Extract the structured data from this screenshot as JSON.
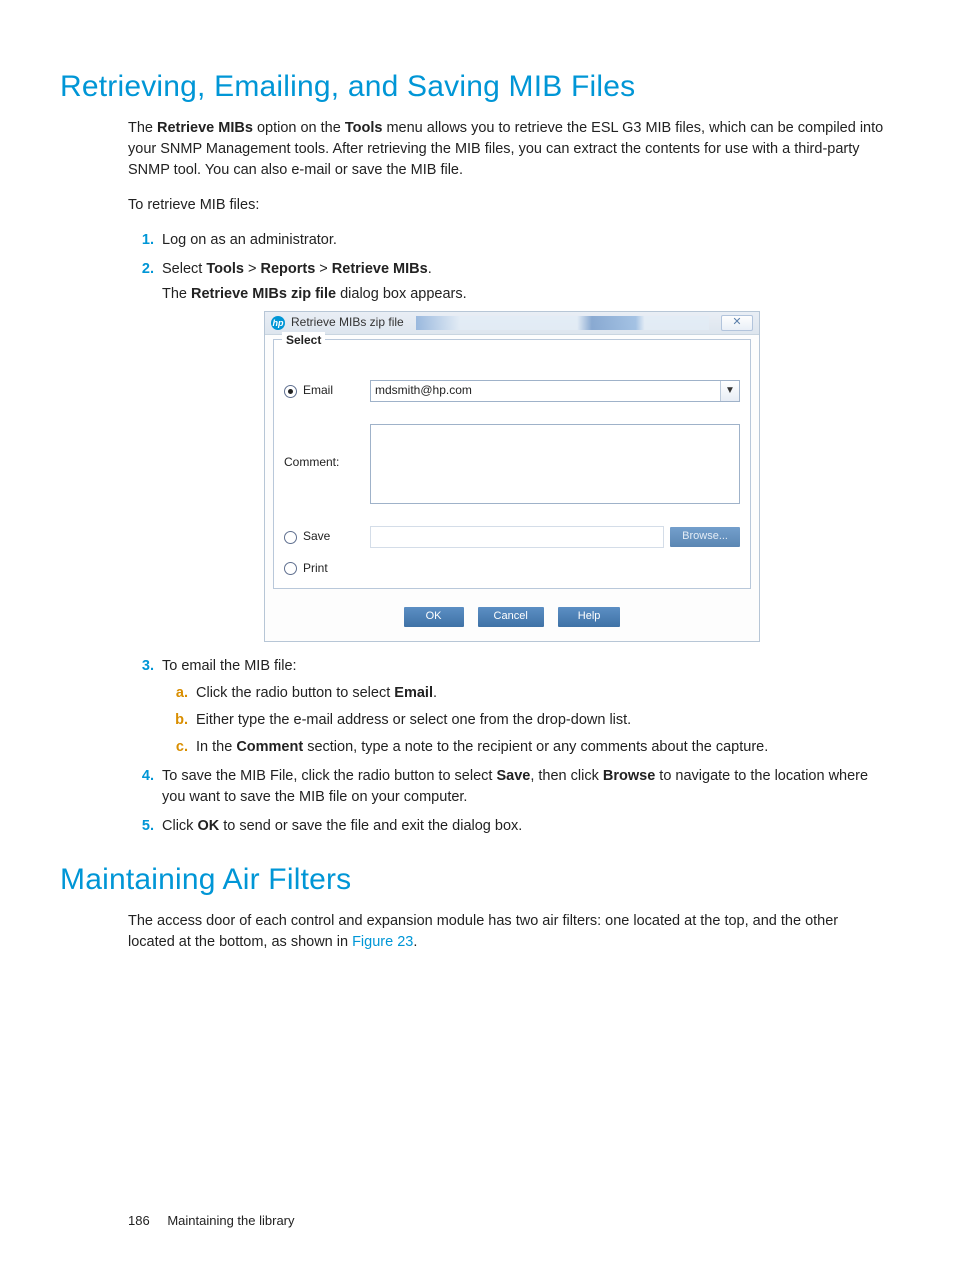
{
  "headings": {
    "h1a": "Retrieving, Emailing, and Saving MIB Files",
    "h1b": "Maintaining Air Filters"
  },
  "intro_parts": {
    "p1_a": "The ",
    "p1_b": "Retrieve MIBs",
    "p1_c": " option on the ",
    "p1_d": "Tools",
    "p1_e": " menu allows you to retrieve the ESL G3 MIB files, which can be compiled into your SNMP Management tools. After retrieving the MIB files, you can extract the contents for use with a third-party SNMP tool. You can also e-mail or save the MIB file.",
    "p2": "To retrieve MIB files:"
  },
  "steps": {
    "s1": "Log on as an administrator.",
    "s2_a": "Select ",
    "s2_b": "Tools",
    "s2_c": " > ",
    "s2_d": "Reports",
    "s2_e": " > ",
    "s2_f": "Retrieve MIBs",
    "s2_g": ".",
    "s2_sub_a": "The ",
    "s2_sub_b": "Retrieve MIBs zip file",
    "s2_sub_c": " dialog box appears.",
    "s3": "To email the MIB file:",
    "s3a_a": "Click the radio button to select ",
    "s3a_b": "Email",
    "s3a_c": ".",
    "s3b": "Either type the e-mail address or select one from the drop-down list.",
    "s3c_a": "In the ",
    "s3c_b": "Comment",
    "s3c_c": " section, type a note to the recipient or any comments about the capture.",
    "s4_a": "To save the MIB File, click the radio button to select ",
    "s4_b": "Save",
    "s4_c": ", then click ",
    "s4_d": "Browse",
    "s4_e": " to navigate to the location where you want to save the MIB file on your computer.",
    "s5_a": "Click ",
    "s5_b": "OK",
    "s5_c": " to send or save the file and exit the dialog box."
  },
  "markers": {
    "n1": "1.",
    "n2": "2.",
    "n3": "3.",
    "n4": "4.",
    "n5": "5.",
    "a": "a.",
    "b": "b.",
    "c": "c."
  },
  "dialog": {
    "title": "Retrieve MIBs zip file",
    "legend": "Select",
    "email_label": "Email",
    "email_value": "mdsmith@hp.com",
    "comment_label": "Comment:",
    "save_label": "Save",
    "print_label": "Print",
    "browse": "Browse...",
    "ok": "OK",
    "cancel": "Cancel",
    "help": "Help",
    "close_glyph": "✕"
  },
  "section2": {
    "p_a": "The access door of each control and expansion module has two air filters: one located at the top, and the other located at the bottom, as shown in ",
    "p_link": "Figure 23",
    "p_b": "."
  },
  "footer": {
    "page": "186",
    "label": "Maintaining the library"
  }
}
